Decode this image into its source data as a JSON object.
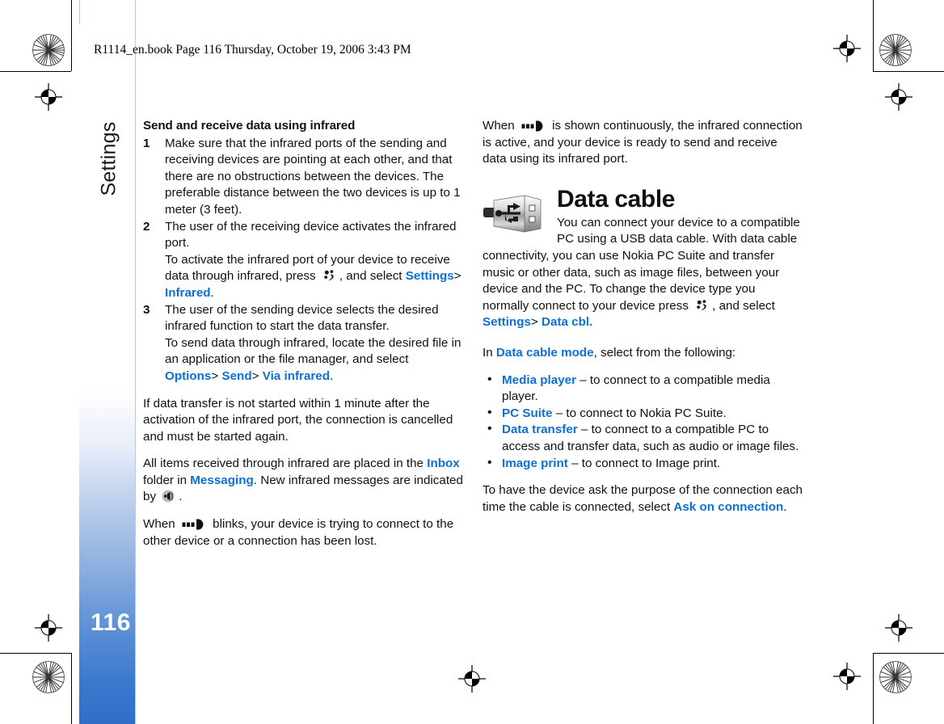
{
  "book_header": "R1114_en.book  Page 116  Thursday, October 19, 2006  3:43 PM",
  "sidebar": {
    "chapter_title": "Settings",
    "page_number": "116",
    "gradient_top": "#ffffff",
    "gradient_bottom": "#2f6fc8"
  },
  "colors": {
    "ui_link": "#0f6ed1",
    "body_text": "#111111",
    "sidebar_blue": "#2f6fc8"
  },
  "left_column": {
    "heading": "Send and receive data using infrared",
    "steps": [
      {
        "num": "1",
        "text": "Make sure that the infrared ports of the sending and receiving devices are pointing at each other, and that there are no obstructions between the devices. The preferable distance between the two devices is up to 1 meter (3 feet)."
      },
      {
        "num": "2",
        "text": "The user of the receiving device activates the infrared port."
      },
      {
        "num": "3",
        "text": "The user of the sending device selects the desired infrared function to start the data transfer."
      }
    ],
    "step2_sub_a": "To activate the infrared port of your device to receive data through infrared, press",
    "step2_sub_b": ", and select",
    "step2_ui_settings": "Settings",
    "step2_sep": ">",
    "step2_ui_infrared": "Infrared",
    "step2_period": ".",
    "step3_sub_a": "To send data through infrared, locate the desired file in an application or the file manager, and select",
    "step3_ui_options": "Options",
    "step3_sep1": ">",
    "step3_ui_send": "Send",
    "step3_sep2": ">",
    "step3_ui_via_infrared": "Via infrared",
    "step3_period": ".",
    "para_timeout": "If data transfer is not started within 1 minute after the activation of the infrared port, the connection is cancelled and must be started again.",
    "para_inbox_a": "All items received through infrared are placed in the",
    "para_inbox_ui": "Inbox",
    "para_inbox_b": "folder in",
    "para_inbox_ui2": "Messaging",
    "para_inbox_c": ". New infrared messages are indicated by",
    "para_inbox_d": ".",
    "para_blink_a": "When",
    "para_blink_b": "blinks, your device is trying to connect to the other device or a connection has been lost."
  },
  "right_column": {
    "para_continuous_a": "When",
    "para_continuous_b": "is shown continuously, the infrared connection is active, and your device is ready to send and receive data using its infrared port.",
    "datacable_heading": "Data cable",
    "datacable_intro_a": "You can connect your device to a compatible PC using a USB data cable. With data cable connectivity, you can use Nokia PC Suite and transfer music or other data, such as image files, between your device and the PC. To change the device type you normally connect to your device press",
    "datacable_intro_b": ", and select",
    "datacable_ui_settings": "Settings",
    "datacable_sep": ">",
    "datacable_ui_datacbl": "Data cbl.",
    "datacable_period": ".",
    "mode_intro_a": "In",
    "mode_intro_ui": "Data cable mode",
    "mode_intro_b": ", select from the following:",
    "bullets": [
      {
        "term": "Media player",
        "desc": "– to connect to a compatible media player."
      },
      {
        "term": "PC Suite",
        "desc": "– to connect to Nokia PC Suite."
      },
      {
        "term": "Data transfer",
        "desc": "– to connect to a compatible PC to access and transfer data, such as audio or image files."
      },
      {
        "term": "Image print",
        "desc": "– to connect to Image print."
      }
    ],
    "para_ask_a": "To have the device ask the purpose of the connection each time the cable is connected, select",
    "para_ask_ui": "Ask on connection",
    "para_ask_b": "."
  },
  "icons": {
    "menu_key": "menu-key-icon",
    "infrared_signal": "infrared-signal-icon",
    "new_message": "new-message-icon",
    "usb_cable": "usb-data-cable-icon",
    "registration": "registration-crosshair-mark",
    "star_target": "star-density-target"
  }
}
